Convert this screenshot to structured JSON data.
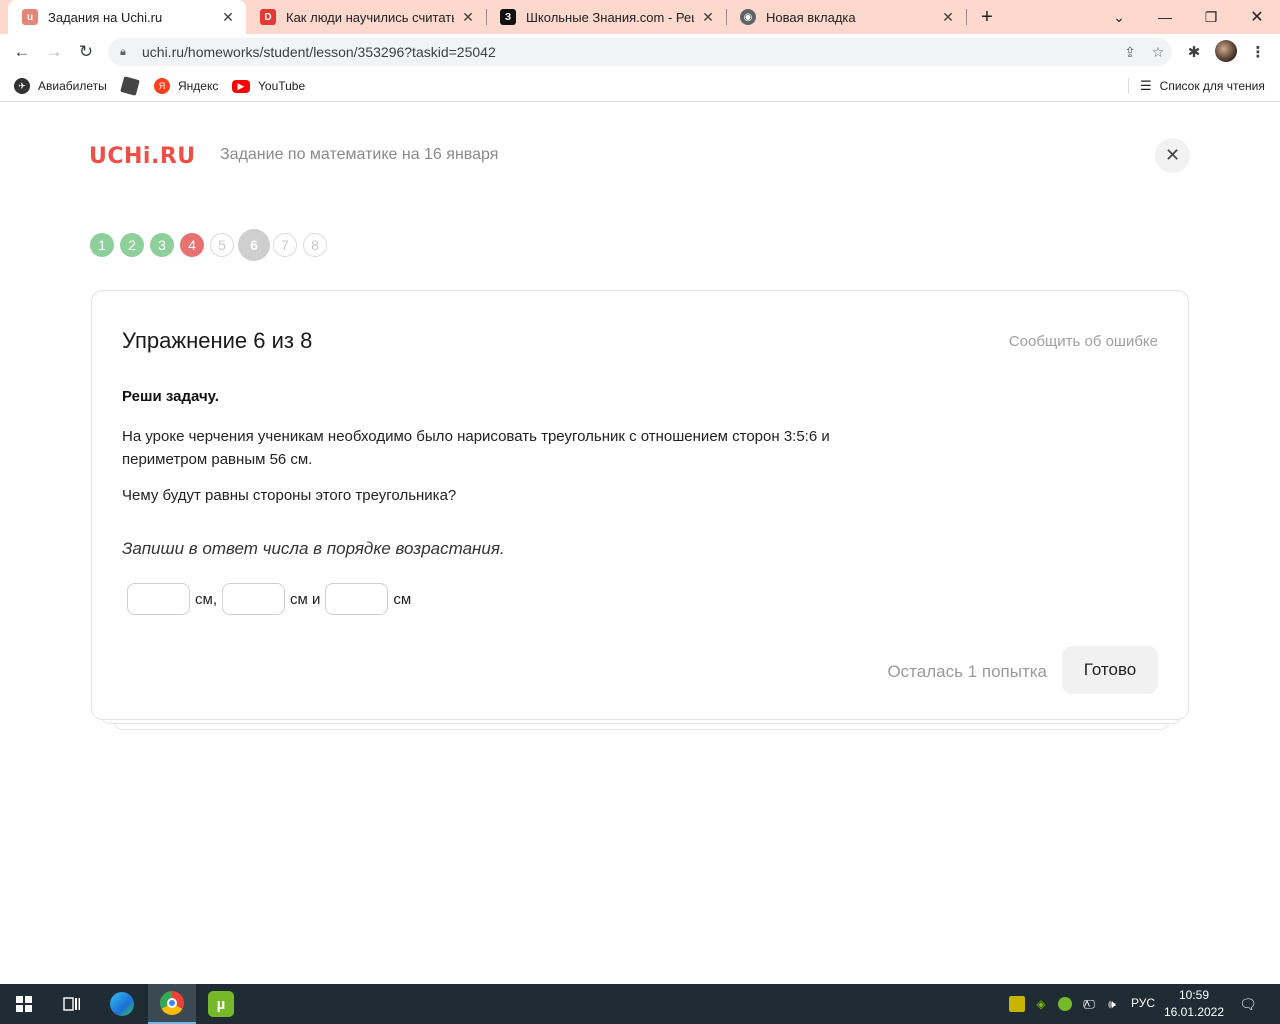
{
  "browser": {
    "tabs": [
      {
        "title": "Задания на Uchi.ru",
        "active": true,
        "favicon": "uchi-favicon"
      },
      {
        "title": "Как люди научились считать? Д",
        "active": false,
        "favicon": "video-favicon"
      },
      {
        "title": "Школьные Знания.com - Решае",
        "active": false,
        "favicon": "znania-favicon"
      },
      {
        "title": "Новая вкладка",
        "active": false,
        "favicon": "chrome-favicon"
      }
    ],
    "url": "uchi.ru/homeworks/student/lesson/353296?taskid=25042",
    "bookmarks": [
      {
        "label": "Авиабилеты",
        "icon": "plane-icon"
      },
      {
        "label": "",
        "icon": "roblox-icon"
      },
      {
        "label": "Яндекс",
        "icon": "yandex-icon"
      },
      {
        "label": "YouTube",
        "icon": "youtube-icon"
      }
    ],
    "reading_list": "Список для чтения"
  },
  "page": {
    "logo": "UCHi.RU",
    "title": "Задание по математике на 16 января",
    "steps": [
      {
        "label": "1",
        "state": "done"
      },
      {
        "label": "2",
        "state": "done"
      },
      {
        "label": "3",
        "state": "done"
      },
      {
        "label": "4",
        "state": "wrong"
      },
      {
        "label": "5",
        "state": "empty"
      },
      {
        "label": "6",
        "state": "current"
      },
      {
        "label": "7",
        "state": "empty"
      },
      {
        "label": "8",
        "state": "empty"
      }
    ],
    "colors": {
      "done": "#8fcf9b",
      "wrong": "#e87272",
      "current": "#cfcfcf",
      "brand": "#ef4f46"
    }
  },
  "exercise": {
    "title": "Упражнение 6 из 8",
    "report": "Сообщить об ошибке",
    "heading": "Реши задачу.",
    "text": "На уроке черчения ученикам необходимо было нарисовать треугольник с отношением сторон 3:5:6 и периметром равным 56 см.",
    "question": "Чему будут равны стороны этого треугольника?",
    "instruction": "Запиши в ответ числа в порядке возрастания.",
    "answers": [
      {
        "value": "",
        "unit": "см,"
      },
      {
        "value": "",
        "unit": "см и"
      },
      {
        "value": "",
        "unit": "см"
      }
    ],
    "attempts": "Осталась 1 попытка",
    "submit": "Готово"
  },
  "taskbar": {
    "lang": "РУС",
    "time": "10:59",
    "date": "16.01.2022"
  }
}
